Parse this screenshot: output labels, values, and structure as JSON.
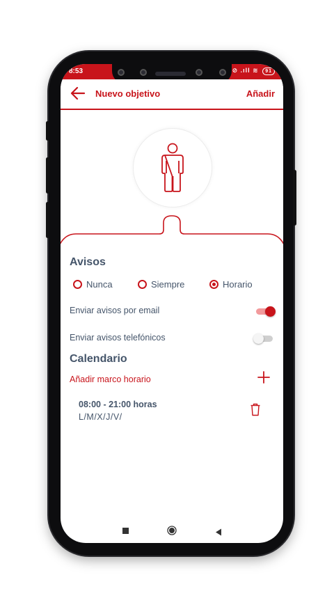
{
  "status_bar": {
    "time": "8:53",
    "icons": "⊘ .ıll ≋",
    "battery": "91"
  },
  "header": {
    "title": "Nuevo objetivo",
    "action_label": "Añadir"
  },
  "avisos": {
    "title": "Avisos",
    "options": [
      "Nunca",
      "Siempre",
      "Horario"
    ],
    "selected": "Horario",
    "email_label": "Enviar avisos por email",
    "email_enabled": true,
    "phone_label": "Enviar avisos telefónicos",
    "phone_enabled": false
  },
  "calendario": {
    "title": "Calendario",
    "add_label": "Añadir marco horario",
    "items": [
      {
        "time": "08:00 - 21:00 horas",
        "days": "L/M/X/J/V/"
      }
    ]
  },
  "colors": {
    "accent": "#c8141b",
    "text": "#45556a"
  }
}
